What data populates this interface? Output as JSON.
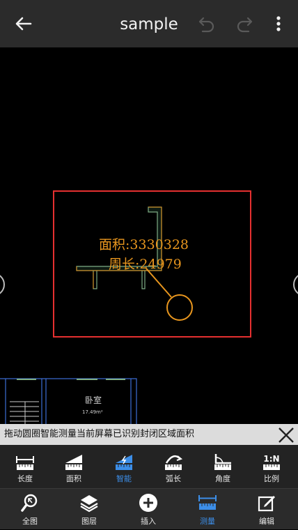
{
  "header": {
    "title": "sample"
  },
  "canvas": {
    "area_text": "面积:3330328",
    "perimeter_text": "周长:24979",
    "room_label": "卧室",
    "room_area": "17.49m²"
  },
  "hint": {
    "text": "拖动圆圈智能测量当前屏幕已识别封闭区域面积"
  },
  "tools": [
    {
      "label": "长度",
      "icon": "length-ruler-icon"
    },
    {
      "label": "面积",
      "icon": "area-ruler-icon"
    },
    {
      "label": "智能",
      "icon": "smart-measure-icon"
    },
    {
      "label": "弧长",
      "icon": "arc-length-icon"
    },
    {
      "label": "角度",
      "icon": "angle-icon"
    },
    {
      "label": "比例",
      "icon": "scale-icon"
    }
  ],
  "nav": [
    {
      "label": "全图",
      "icon": "zoom-extent-icon"
    },
    {
      "label": "图层",
      "icon": "layers-icon"
    },
    {
      "label": "插入",
      "icon": "insert-plus-icon"
    },
    {
      "label": "测量",
      "icon": "measure-ruler-icon"
    },
    {
      "label": "编辑",
      "icon": "edit-pencil-icon"
    }
  ],
  "colors": {
    "accent": "#3c8ee8",
    "measure": "#e8961e",
    "selection": "#e53030",
    "wall": "#7fae86",
    "topbar": "#2b2b2b"
  }
}
